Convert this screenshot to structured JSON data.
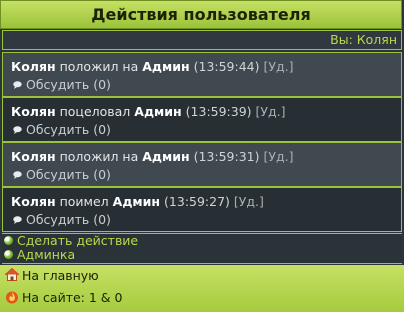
{
  "header": {
    "title": "Действия пользователя"
  },
  "user_bar": {
    "label": "Вы:",
    "user": "Колян"
  },
  "posts": [
    {
      "actor": "Колян",
      "action": "положил на",
      "target": "Админ",
      "time": "(13:59:44)",
      "delete": "[Уд.]",
      "discuss": "Обсудить",
      "count": "(0)"
    },
    {
      "actor": "Колян",
      "action": "поцеловал",
      "target": "Админ",
      "time": "(13:59:39)",
      "delete": "[Уд.]",
      "discuss": "Обсудить",
      "count": "(0)"
    },
    {
      "actor": "Колян",
      "action": "положил на",
      "target": "Админ",
      "time": "(13:59:31)",
      "delete": "[Уд.]",
      "discuss": "Обсудить",
      "count": "(0)"
    },
    {
      "actor": "Колян",
      "action": "поимел",
      "target": "Админ",
      "time": "(13:59:27)",
      "delete": "[Уд.]",
      "discuss": "Обсудить",
      "count": "(0)"
    }
  ],
  "links": {
    "make_action": "Сделать действие",
    "admin": "Админка"
  },
  "footer": {
    "home": "На главную",
    "online": "На сайте: 1 & 0"
  },
  "colors": {
    "accent": "#9bc33a",
    "link": "#b8da4a",
    "panel": "#2c353b"
  },
  "icons": {
    "bubble": "comment-bubble-icon",
    "dot": "bullet-dot-icon",
    "home": "home-icon",
    "online": "online-fire-icon"
  }
}
